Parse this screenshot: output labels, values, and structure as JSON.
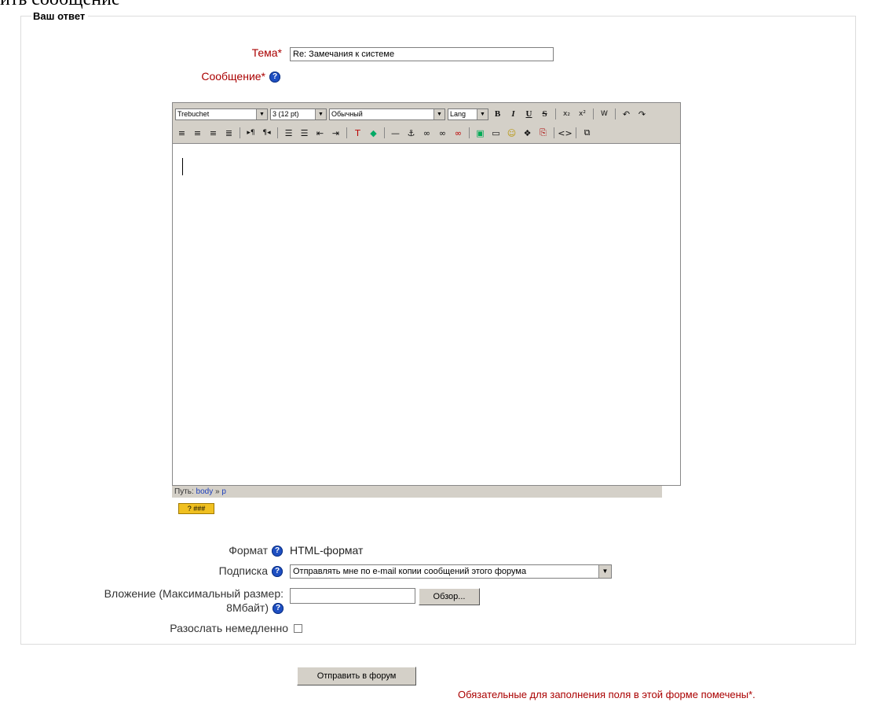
{
  "page_heading": "ить сообщение",
  "form": {
    "legend": "Ваш ответ",
    "subject_label": "Тема",
    "subject_value": "Re: Замечания к системе",
    "message_label": "Сообщение",
    "required_mark": "*",
    "help_glyph": "?"
  },
  "editor": {
    "font_select": "Trebuchet",
    "size_select": "3 (12 pt)",
    "style_select": "Обычный",
    "lang_select": "Lang",
    "path_label": "Путь:",
    "path_items": [
      "body",
      "p"
    ],
    "path_sep": "»",
    "keyboard_help": "? ###"
  },
  "options": {
    "format_label": "Формат",
    "format_value": "HTML-формат",
    "subscription_label": "Подписка",
    "subscription_value": "Отправлять мне по e-mail копии сообщений этого форума",
    "attachment_label_line1": "Вложение (Максимальный размер:",
    "attachment_label_line2": "8Мбайт)",
    "browse_button": "Обзор...",
    "mail_now_label": "Разослать немедленно"
  },
  "submit_button": "Отправить в форум",
  "required_note": "Обязательные для заполнения поля в этой форме помечены*."
}
